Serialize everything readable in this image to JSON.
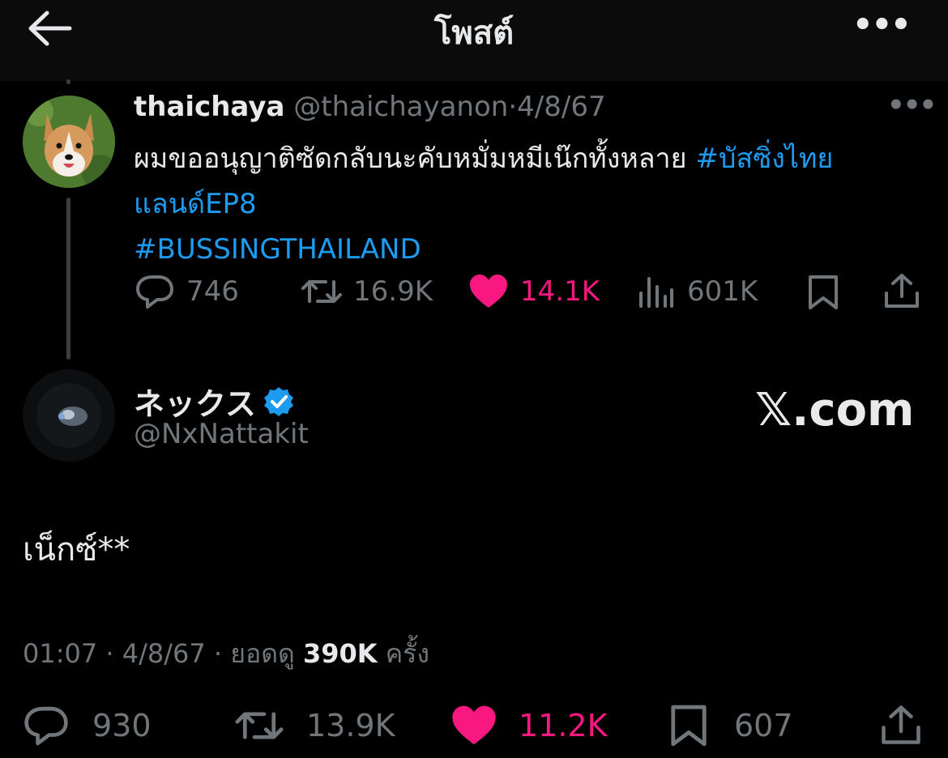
{
  "header": {
    "title": "โพสต์",
    "back_icon": "arrow-left-icon",
    "more_label": "•••"
  },
  "colors": {
    "background": "#000000",
    "text": "#e7e9ea",
    "muted": "#71767b",
    "link": "#1d9bf0",
    "like": "#f91880"
  },
  "quoted_post": {
    "display_name": "thaichaya",
    "handle": "@thaichayanon",
    "separator": "·",
    "date": "4/8/67",
    "more_label": "•••",
    "text": "ผมขออนุญาติซัดกลับนะคับหมั่มหมีเน๊กทั้งหลาย ",
    "hashtag1": "#บัสซิ่งไทยแลนด์EP8",
    "hashtag2": "#BUSSINGTHAILAND",
    "actions": {
      "replies": "746",
      "reposts": "16.9K",
      "likes": "14.1K",
      "views": "601K"
    }
  },
  "main_post": {
    "display_name": "ネックス",
    "verified": true,
    "handle": "@NxNattakit",
    "brand": "𝕏.com",
    "text": "เน็กซ์**",
    "time": "01:07",
    "date": "4/8/67",
    "views_label": "ยอดดู",
    "views": "390K",
    "views_suffix": "ครั้ง",
    "separator": "·",
    "actions": {
      "replies": "930",
      "reposts": "13.9K",
      "likes": "11.2K",
      "bookmarks": "607"
    }
  }
}
